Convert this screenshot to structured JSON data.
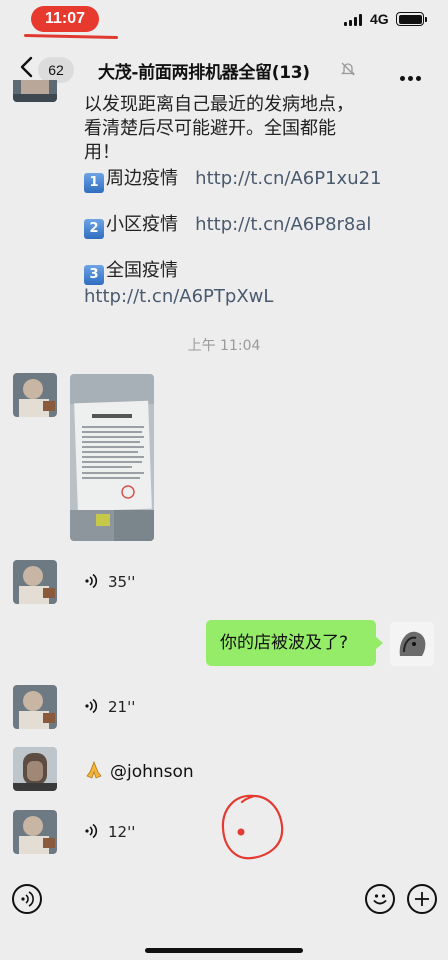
{
  "status_bar": {
    "time": "11:07",
    "network": "4G"
  },
  "header": {
    "back_count": "62",
    "title": "大茂-前面两排机器全留(13)"
  },
  "messages": {
    "text_lines": [
      "以发现距离自己最近的发病地点，",
      "看清楚后尽可能避开。全国都能",
      "用！"
    ],
    "items": [
      {
        "key": "1",
        "label": "周边疫情",
        "link": "http://t.cn/A6P1xu21"
      },
      {
        "key": "2",
        "label": "小区疫情",
        "link": "http://t.cn/A6P8r8al"
      },
      {
        "key": "3",
        "label": "全国疫情",
        "link": "http://t.cn/A6PTpXwL"
      }
    ],
    "timestamp": "上午 11:04",
    "voice1": "35''",
    "outgoing": "你的店被波及了?",
    "voice2": "21''",
    "mention": "@johnson",
    "voice3": "12''"
  }
}
